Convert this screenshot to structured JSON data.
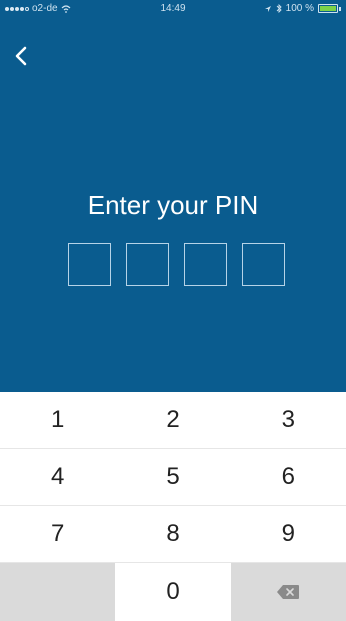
{
  "status_bar": {
    "carrier": "o2-de",
    "time": "14:49",
    "battery_text": "100 %",
    "battery_level": 1.0
  },
  "screen": {
    "title": "Enter your PIN",
    "pin_length": 4
  },
  "keypad": {
    "rows": [
      [
        "1",
        "2",
        "3"
      ],
      [
        "4",
        "5",
        "6"
      ],
      [
        "7",
        "8",
        "9"
      ]
    ],
    "zero": "0"
  },
  "colors": {
    "header_bg": "#0a5c8f",
    "keypad_bg": "#ffffff",
    "gray_key": "#dadada"
  },
  "icons": {
    "back": "chevron-left-icon",
    "delete": "backspace-icon"
  }
}
